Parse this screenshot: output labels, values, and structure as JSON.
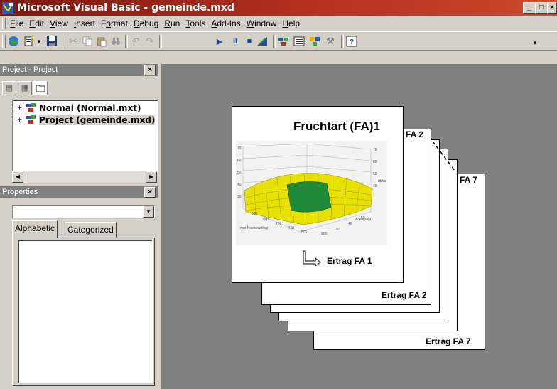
{
  "window": {
    "title": "Microsoft Visual Basic - gemeinde.mxd",
    "controls": [
      "_",
      "□",
      "×"
    ]
  },
  "menu": {
    "items": [
      {
        "label": "File",
        "u": "F"
      },
      {
        "label": "Edit",
        "u": "E"
      },
      {
        "label": "View",
        "u": "V"
      },
      {
        "label": "Insert",
        "u": "I"
      },
      {
        "label": "Format",
        "u": "o"
      },
      {
        "label": "Debug",
        "u": "D"
      },
      {
        "label": "Run",
        "u": "R"
      },
      {
        "label": "Tools",
        "u": "T"
      },
      {
        "label": "Add-Ins",
        "u": "A"
      },
      {
        "label": "Window",
        "u": "W"
      },
      {
        "label": "Help",
        "u": "H"
      }
    ]
  },
  "toolbar": {
    "buttons": [
      "arcmap-icon",
      "insert-module-icon",
      "save-icon",
      "cut-icon",
      "copy-icon",
      "paste-icon",
      "find-icon",
      "undo-icon",
      "redo-icon",
      "run-icon",
      "break-icon",
      "reset-icon",
      "design-mode-icon",
      "project-explorer-icon",
      "properties-window-icon",
      "object-browser-icon",
      "toolbox-icon",
      "help-icon"
    ]
  },
  "project_panel": {
    "title": "Project - Project",
    "close": "×",
    "tree": [
      {
        "label": "Normal (Normal.mxt)",
        "expander": "+"
      },
      {
        "label": "Project (gemeinde.mxd)",
        "expander": "+"
      }
    ]
  },
  "properties_panel": {
    "title": "Properties",
    "close": "×",
    "combo_value": "",
    "tabs": [
      "Alphabetic",
      "Categorized"
    ]
  },
  "diagram": {
    "front_title": "Fruchtart (FA)1",
    "front_caption": "Ertrag FA 1",
    "card2_label": "FA 2",
    "card2_caption": "Ertrag FA 2",
    "card7_label": "FA 7",
    "card7_caption": "Ertrag FA 7",
    "plot_axis_labels": {
      "left": "mm Niederschlag",
      "right": "Ackerzahl",
      "side": "dt/ha"
    },
    "colors": {
      "surface": "#e8e000",
      "patch": "#1e8a3a"
    }
  }
}
